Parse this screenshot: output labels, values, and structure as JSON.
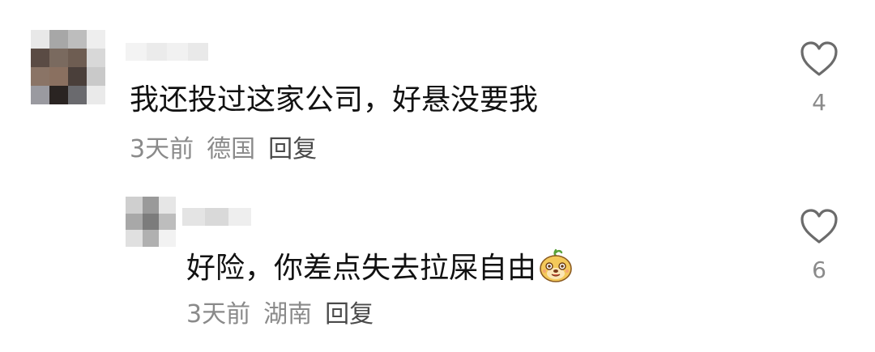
{
  "comments": [
    {
      "text": "我还投过这家公司，好悬没要我",
      "time": "3天前",
      "location": "德国",
      "reply_label": "回复",
      "likes": "4",
      "avatar_colors": [
        "#e8e8e8",
        "#a7a7a7",
        "#bdbdbd",
        "#eeeeee",
        "#5a4b44",
        "#7a6a5f",
        "#6e5d52",
        "#d8d8d8",
        "#8a7466",
        "#8a7060",
        "#4a3f3a",
        "#c9c9c9",
        "#9a9aa0",
        "#2a2422",
        "#6a6a6e",
        "#eaeaea"
      ]
    },
    {
      "text": "好险，你差点失去拉屎自由",
      "emoji_icon": "smiling-dog-emoji-icon",
      "time": "3天前",
      "location": "湖南",
      "reply_label": "回复",
      "likes": "6",
      "avatar_colors": [
        "#cfcfcf",
        "#9a9a9a",
        "#e6e6e6",
        "#a8a8a8",
        "#7c7c7c",
        "#bdbdbd",
        "#e0e0e0",
        "#b0b0b0",
        "#f2f2f2"
      ]
    }
  ],
  "icons": {
    "like": "heart-outline-icon"
  },
  "colors": {
    "text": "#111111",
    "meta": "#8a8a8a",
    "reply": "#4a4a4a",
    "heart_stroke": "#6b6b6b"
  }
}
